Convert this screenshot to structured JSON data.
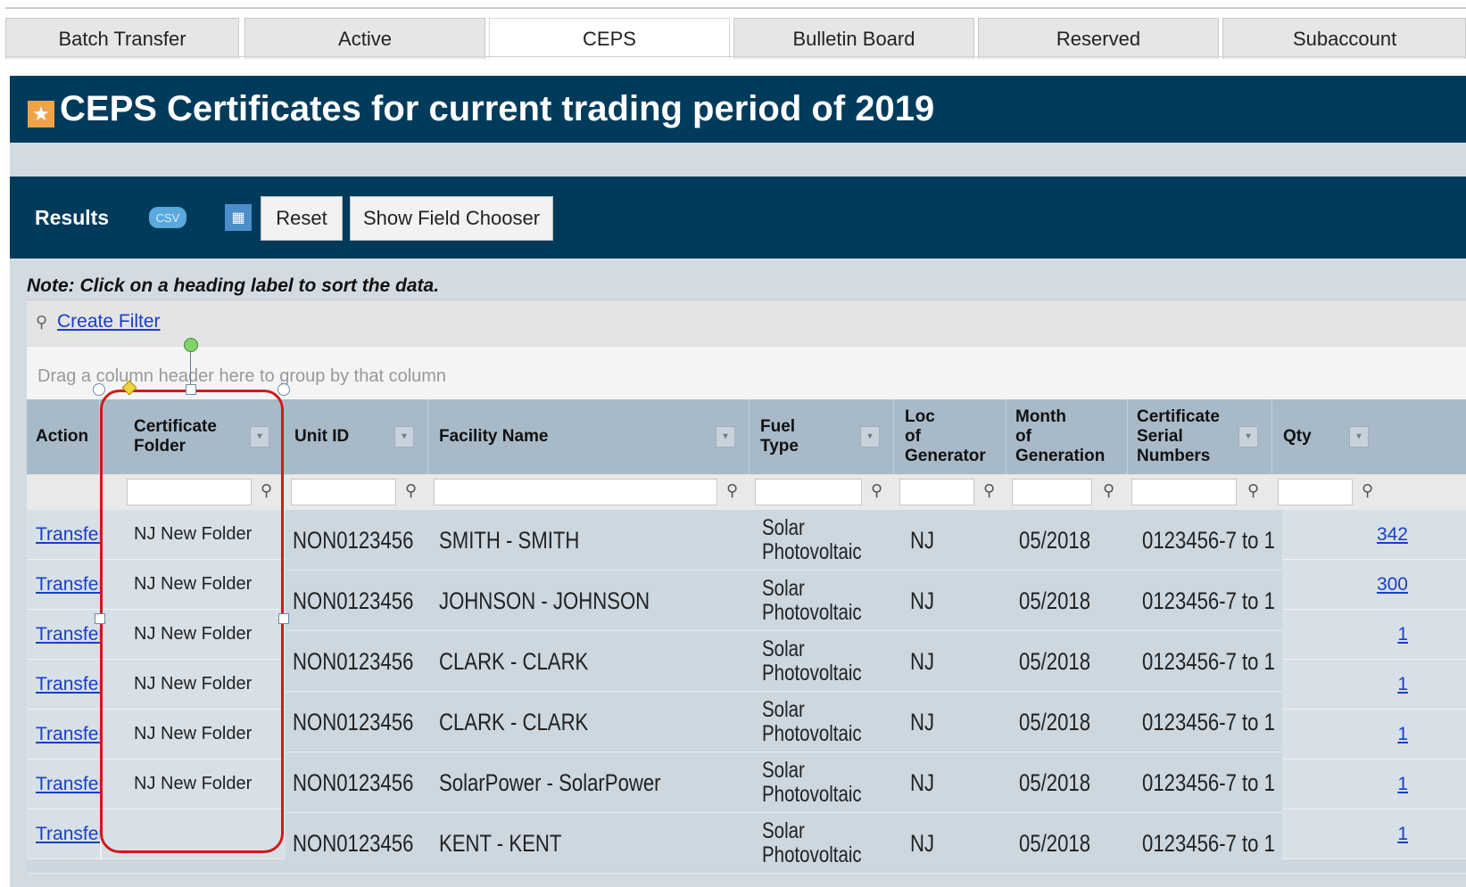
{
  "tabs": [
    {
      "label": "Batch Transfer",
      "active": false
    },
    {
      "label": "Active",
      "active": false
    },
    {
      "label": "CEPS",
      "active": true
    },
    {
      "label": "Bulletin Board",
      "active": false
    },
    {
      "label": "Reserved",
      "active": false
    },
    {
      "label": "Subaccount",
      "active": false
    }
  ],
  "title": "CEPS Certificates for current trading period of 2019",
  "results": {
    "label": "Results",
    "csv_label": "CSV",
    "reset_label": "Reset",
    "field_chooser_label": "Show Field Chooser"
  },
  "note": "Note: Click on a heading label to sort the data.",
  "filter": {
    "create_filter_label": "Create Filter"
  },
  "group_hint": "Drag a column header here to group by that column",
  "columns": [
    {
      "key": "action",
      "line1": "Action",
      "line2": "",
      "line3": ""
    },
    {
      "key": "folder",
      "line1": "Certificate",
      "line2": "Folder",
      "line3": ""
    },
    {
      "key": "unit",
      "line1": "Unit ID",
      "line2": "",
      "line3": ""
    },
    {
      "key": "facility",
      "line1": "Facility Name",
      "line2": "",
      "line3": ""
    },
    {
      "key": "fuel",
      "line1": "Fuel",
      "line2": "Type",
      "line3": ""
    },
    {
      "key": "loc",
      "line1": "Loc",
      "line2": "of",
      "line3": "Generator"
    },
    {
      "key": "month",
      "line1": "Month",
      "line2": "of",
      "line3": "Generation"
    },
    {
      "key": "serial",
      "line1": "Certificate",
      "line2": "Serial",
      "line3": "Numbers"
    },
    {
      "key": "qty",
      "line1": "Qty",
      "line2": "",
      "line3": ""
    }
  ],
  "left_rows": [
    {
      "action": "Transfer",
      "folder": "NJ New Folder"
    },
    {
      "action": "Transfer",
      "folder": "NJ New Folder"
    },
    {
      "action": "Transfer",
      "folder": "NJ New Folder"
    },
    {
      "action": "Transfer",
      "folder": "NJ New Folder"
    },
    {
      "action": "Transfer",
      "folder": "NJ New Folder"
    },
    {
      "action": "Transfer",
      "folder": "NJ New Folder"
    },
    {
      "action": "Transfer",
      "folder": ""
    }
  ],
  "rows": [
    {
      "unit": "NON0123456",
      "facility": "SMITH - SMITH",
      "fuel1": "Solar",
      "fuel2": "Photovoltaic",
      "loc": "NJ",
      "month": "05/2018",
      "serial": "0123456-7 to 1"
    },
    {
      "unit": "NON0123456",
      "facility": "JOHNSON - JOHNSON",
      "fuel1": "Solar",
      "fuel2": "Photovoltaic",
      "loc": "NJ",
      "month": "05/2018",
      "serial": "0123456-7 to 1"
    },
    {
      "unit": "NON0123456",
      "facility": "CLARK - CLARK",
      "fuel1": "Solar",
      "fuel2": "Photovoltaic",
      "loc": "NJ",
      "month": "05/2018",
      "serial": "0123456-7 to 1"
    },
    {
      "unit": "NON0123456",
      "facility": "CLARK - CLARK",
      "fuel1": "Solar",
      "fuel2": "Photovoltaic",
      "loc": "NJ",
      "month": "05/2018",
      "serial": "0123456-7 to 1"
    },
    {
      "unit": "NON0123456",
      "facility": "SolarPower - SolarPower",
      "fuel1": "Solar",
      "fuel2": "Photovoltaic",
      "loc": "NJ",
      "month": "05/2018",
      "serial": "0123456-7 to 1"
    },
    {
      "unit": "NON0123456",
      "facility": "KENT - KENT",
      "fuel1": "Solar",
      "fuel2": "Photovoltaic",
      "loc": "NJ",
      "month": "05/2018",
      "serial": "0123456-7 to 1"
    }
  ],
  "qty_rows": [
    "342",
    "300",
    "1",
    "1",
    "1",
    "1",
    "1"
  ],
  "colors": {
    "header_bg": "#003b5c",
    "panel_bg": "#d2dbe2",
    "link": "#1a3ec6",
    "selection": "#d01a1a"
  }
}
